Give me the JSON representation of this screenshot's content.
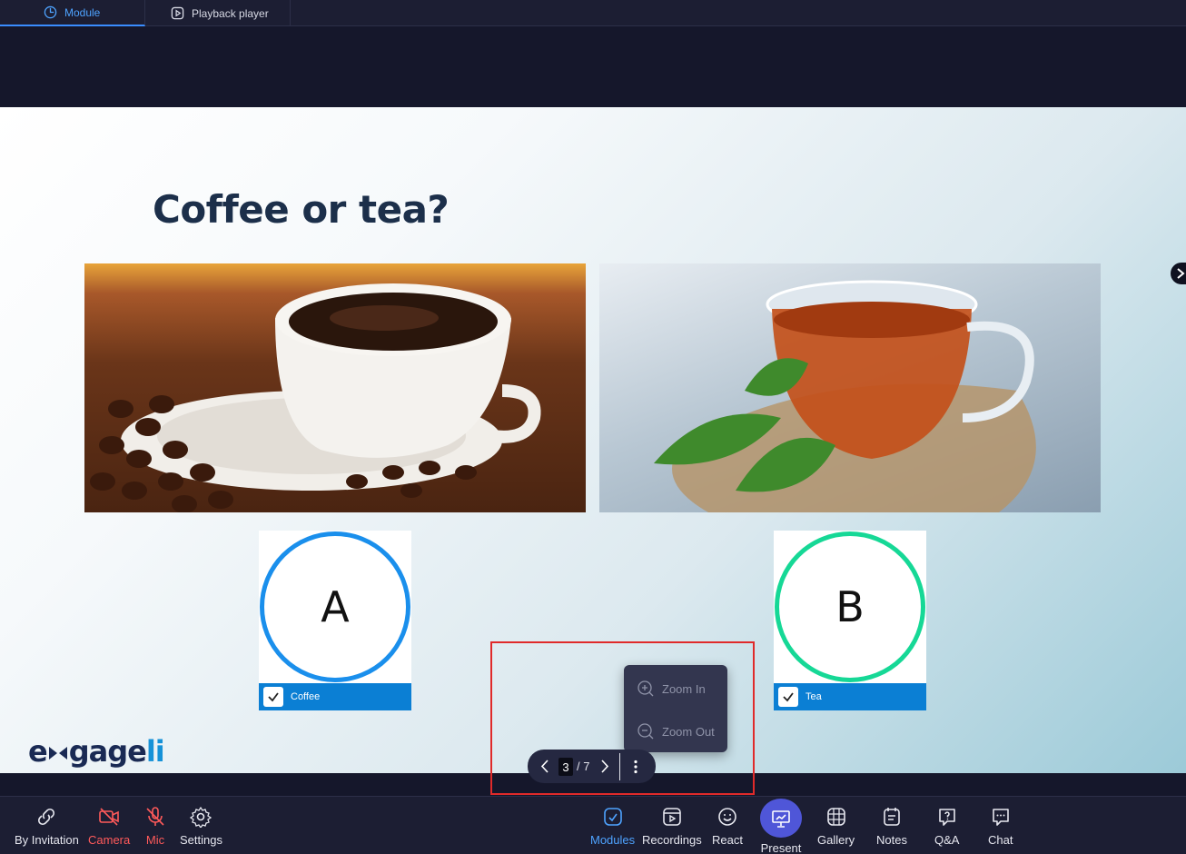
{
  "tabs": [
    {
      "label": "Module",
      "icon": "module-icon",
      "active": true
    },
    {
      "label": "Playback player",
      "icon": "playback-icon",
      "active": false
    }
  ],
  "slide": {
    "title": "Coffee or tea?",
    "options": [
      {
        "letter": "A",
        "label": "Coffee",
        "color": "#1a8fec",
        "checked": true
      },
      {
        "letter": "B",
        "label": "Tea",
        "color": "#16d896",
        "checked": true
      }
    ],
    "logo_prefix": "e",
    "logo_mid": "gage",
    "logo_suffix": "li"
  },
  "zoom_menu": {
    "zoom_in": "Zoom In",
    "zoom_out": "Zoom Out"
  },
  "pager": {
    "current": "3",
    "total": "/ 7"
  },
  "toolbar": {
    "by_invitation": "By Invitation",
    "camera": "Camera",
    "mic": "Mic",
    "settings": "Settings",
    "modules": "Modules",
    "recordings": "Recordings",
    "react": "React",
    "present": "Present",
    "gallery": "Gallery",
    "notes": "Notes",
    "qa": "Q&A",
    "chat": "Chat"
  },
  "colors": {
    "accent": "#4ea3ff",
    "muted_red": "#ff5a5a",
    "present": "#4f56d8",
    "highlight": "#e02a2a"
  }
}
